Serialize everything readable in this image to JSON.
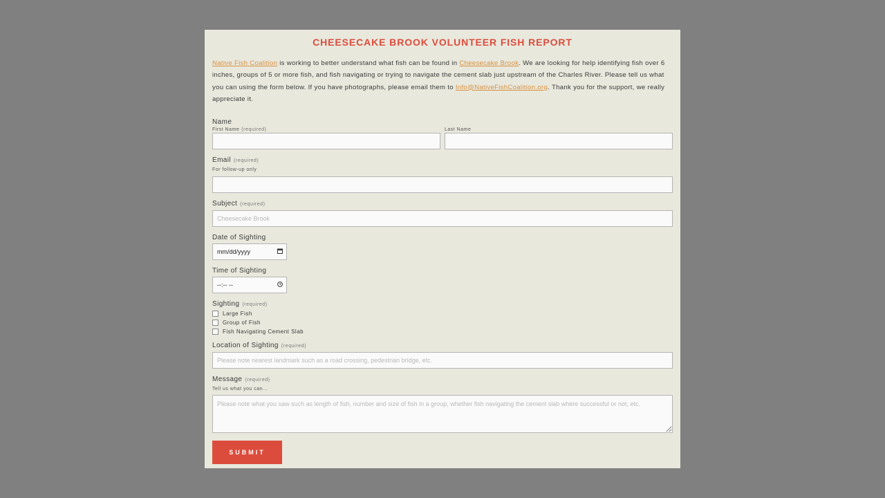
{
  "form": {
    "title": "CHEESECAKE BROOK VOLUNTEER FISH REPORT",
    "intro": {
      "link_org": "Native Fish Coalition",
      "text1": " is working to better understand what fish can be found in ",
      "link_brook": "Cheesecake Brook",
      "text2": ".  We are looking for help identifying fish over 6 inches, groups of 5 or more fish, and fish navigating or trying to navigate the cement slab just upstream of the Charles River.  Please tell us what you can using the form below.  If you have photographs, please email them to ",
      "link_email": "Info@NativeFishCoalition.org",
      "text3": ".  Thank you for the support, we really appreciate it."
    },
    "name": {
      "label": "Name",
      "first_label": "First Name",
      "first_required": "(required)",
      "last_label": "Last Name",
      "first_value": "",
      "last_value": ""
    },
    "email": {
      "label": "Email",
      "required": "(required)",
      "hint": "For follow-up only",
      "value": ""
    },
    "subject": {
      "label": "Subject",
      "required": "(required)",
      "placeholder": "Cheesecake Brook"
    },
    "date": {
      "label": "Date of Sighting",
      "value": "mm/dd/yyyy",
      "icon": "calendar-icon"
    },
    "time": {
      "label": "Time of Sighting",
      "value": "--:-- --",
      "icon": "clock-icon"
    },
    "sighting": {
      "label": "Sighting",
      "required": "(required)",
      "options": [
        "Large Fish",
        "Group of Fish",
        "Fish Navigating Cement Slab"
      ]
    },
    "location": {
      "label": "Location of Sighting",
      "required": "(required)",
      "placeholder": "Please note nearest landmark such as a road crossing, pedestrian bridge, etc."
    },
    "message": {
      "label": "Message",
      "required": "(required)",
      "hint": "Tell us what you can...",
      "placeholder": "Please note what you saw such as length of fish, number and size of fish in a group, whether fish navigating the cement slab where successful or not, etc."
    },
    "submit_label": "SUBMIT"
  },
  "colors": {
    "page_bg": "#808080",
    "panel_bg": "#e8e8dd",
    "accent_red": "#dc4c3c",
    "link_orange": "#d9913f"
  }
}
